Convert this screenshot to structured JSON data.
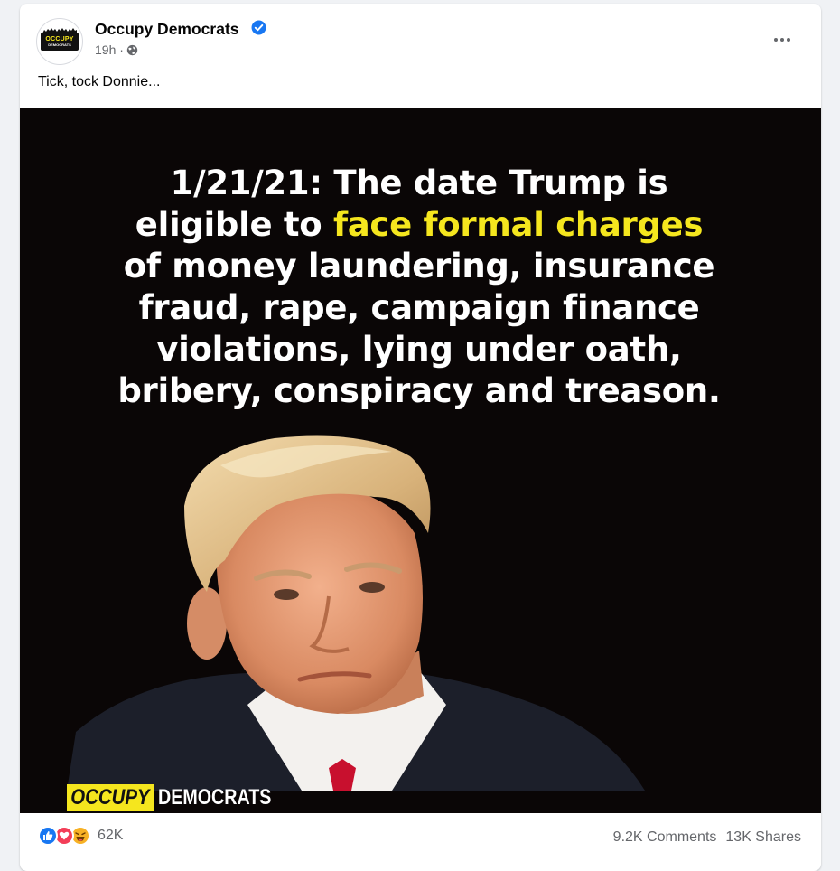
{
  "post": {
    "author": "Occupy Democrats",
    "time": "19h ·",
    "caption": "Tick, tock Donnie...",
    "avatar_text_top": "OCCUPY",
    "avatar_text_bottom": "DEMOCRATS"
  },
  "image": {
    "line1": "1/21/21: The date Trump is",
    "line2_prefix": "eligible to ",
    "line2_highlight": "face formal charges",
    "line3": "of money laundering, insurance",
    "line4": "fraud, rape, campaign finance",
    "line5": "violations, lying under oath,",
    "line6": "bribery, conspiracy and treason.",
    "brand_occupy": "OCCUPY",
    "brand_democrats": "DEMOCRATS"
  },
  "stats": {
    "reactions": "62K",
    "comments": "9.2K Comments",
    "shares": "13K Shares"
  },
  "colors": {
    "brand_yellow": "#f5e61e",
    "like_blue": "#1877f2",
    "love_red": "#f33e58",
    "haha_yellow": "#f7b125",
    "verified_blue": "#1877f2"
  },
  "icons": {
    "verified": "verified-badge-icon",
    "privacy": "globe-icon",
    "menu": "more-options-icon",
    "reactions": [
      "like-icon",
      "love-icon",
      "haha-icon"
    ]
  }
}
